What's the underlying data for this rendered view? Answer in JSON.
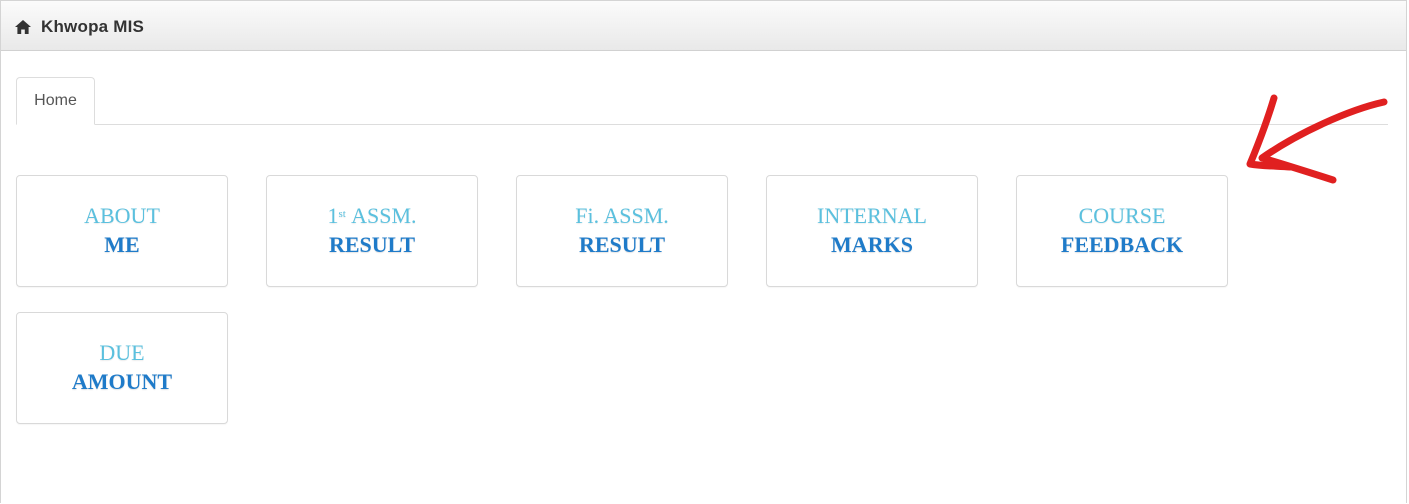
{
  "navbar": {
    "brand": "Khwopa MIS",
    "icon": "home-icon"
  },
  "tabs": [
    {
      "label": "Home",
      "active": true
    }
  ],
  "tiles": [
    {
      "line1": "ABOUT",
      "line2": "ME"
    },
    {
      "line1_sup_prefix": "1",
      "line1_sup": "st",
      "line1": "ASSM.",
      "line2": "RESULT"
    },
    {
      "line1": "Fi. ASSM.",
      "line2": "RESULT"
    },
    {
      "line1": "INTERNAL",
      "line2": "MARKS"
    },
    {
      "line1": "COURSE",
      "line2": "FEEDBACK"
    },
    {
      "line1": "DUE",
      "line2": "AMOUNT"
    }
  ],
  "colors": {
    "tile_line1": "#5bc0de",
    "tile_line2": "#1f7bc9",
    "annotation_arrow": "#e02020"
  }
}
